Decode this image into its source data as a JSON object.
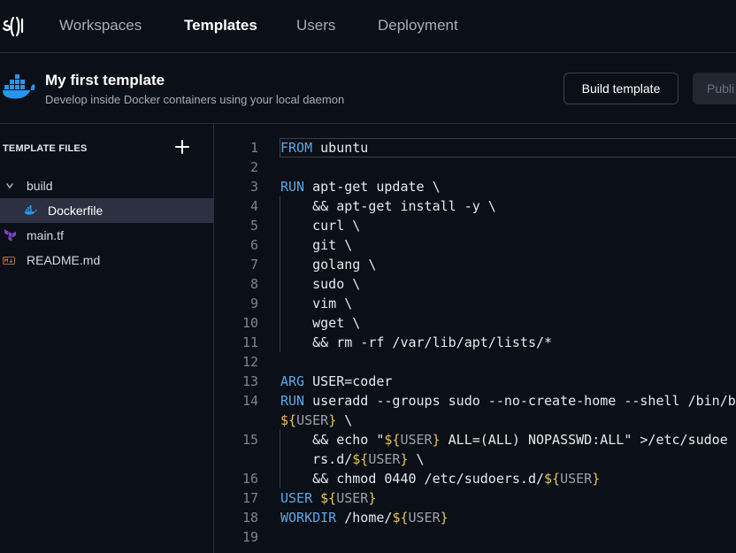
{
  "nav": {
    "items": [
      {
        "label": "Workspaces",
        "active": false
      },
      {
        "label": "Templates",
        "active": true
      },
      {
        "label": "Users",
        "active": false
      },
      {
        "label": "Deployment",
        "active": false
      }
    ]
  },
  "template": {
    "title": "My first template",
    "description": "Develop inside Docker containers using your local daemon",
    "build_label": "Build template",
    "publish_label": "Publi"
  },
  "sidebar": {
    "title": "TEMPLATE FILES",
    "items": [
      {
        "label": "build",
        "icon": "chevron-down-icon"
      },
      {
        "label": "Dockerfile",
        "icon": "docker-icon",
        "selected": true
      },
      {
        "label": "main.tf",
        "icon": "terraform-icon"
      },
      {
        "label": "README.md",
        "icon": "markdown-icon"
      }
    ]
  },
  "editor": {
    "lines": [
      {
        "n": "1",
        "text": "FROM ubuntu"
      },
      {
        "n": "2",
        "text": ""
      },
      {
        "n": "3",
        "text": "RUN apt-get update \\"
      },
      {
        "n": "4",
        "text": "    && apt-get install -y \\"
      },
      {
        "n": "5",
        "text": "    curl \\"
      },
      {
        "n": "6",
        "text": "    git \\"
      },
      {
        "n": "7",
        "text": "    golang \\"
      },
      {
        "n": "8",
        "text": "    sudo \\"
      },
      {
        "n": "9",
        "text": "    vim \\"
      },
      {
        "n": "10",
        "text": "    wget \\"
      },
      {
        "n": "11",
        "text": "    && rm -rf /var/lib/apt/lists/*"
      },
      {
        "n": "12",
        "text": ""
      },
      {
        "n": "13",
        "text": "ARG USER=coder"
      },
      {
        "n": "14",
        "text": "RUN useradd --groups sudo --no-create-home --shell /bin/bash ${USER} \\"
      },
      {
        "n": "15",
        "text": "    && echo \"${USER} ALL=(ALL) NOPASSWD:ALL\" >/etc/sudoers.d/${USER} \\"
      },
      {
        "n": "16",
        "text": "    && chmod 0440 /etc/sudoers.d/${USER}"
      },
      {
        "n": "17",
        "text": "USER ${USER}"
      },
      {
        "n": "18",
        "text": "WORKDIR /home/${USER}"
      },
      {
        "n": "19",
        "text": ""
      }
    ]
  },
  "colors": {
    "background": "#0b0f17",
    "keyword": "#5aa8e8",
    "brace": "#e8c45a",
    "docker_blue": "#2496ed",
    "terraform_purple": "#7b42bc"
  }
}
